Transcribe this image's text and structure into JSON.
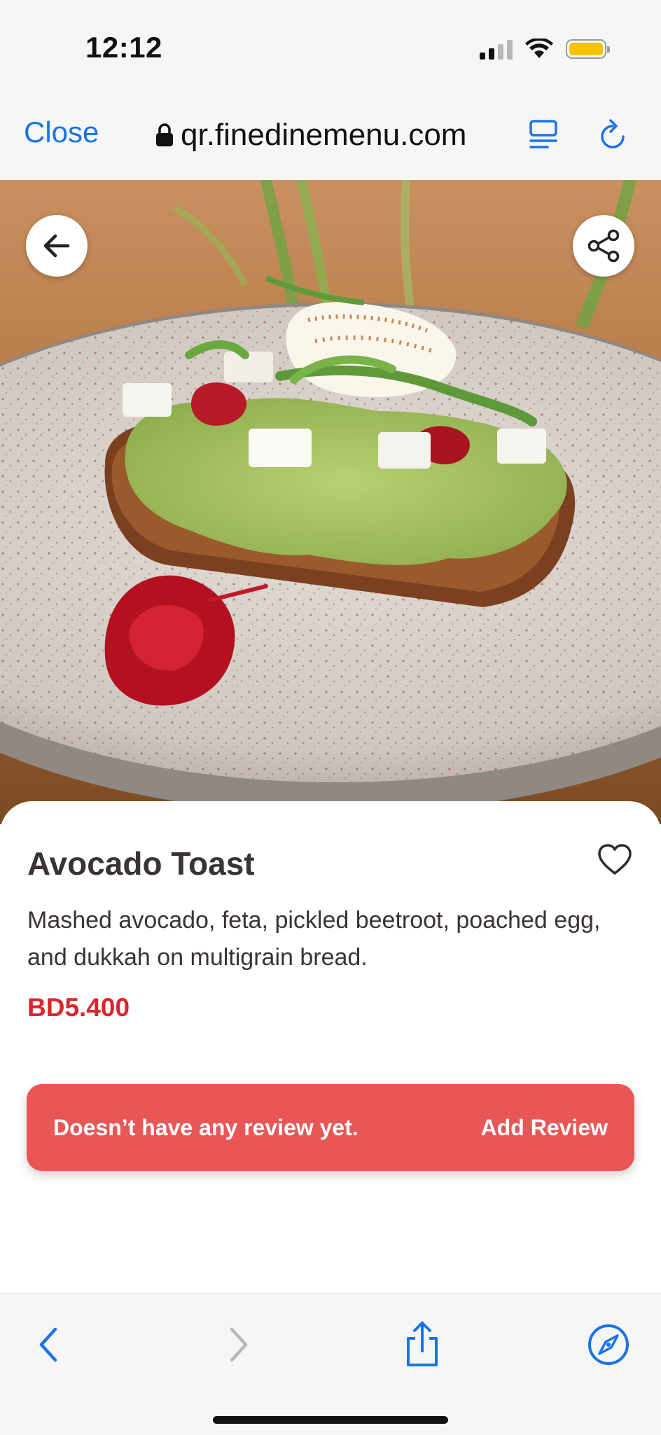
{
  "status_bar": {
    "time": "12:12",
    "battery_color": "#f5c400"
  },
  "browser": {
    "close_label": "Close",
    "url": "qr.finedinemenu.com",
    "accent_color": "#1a73e8"
  },
  "hero": {
    "image_subject": "avocado toast on speckled plate",
    "back_icon": "arrow-left-icon",
    "share_icon": "share-icon"
  },
  "item": {
    "title": "Avocado Toast",
    "description": "Mashed avocado, feta, pickled beetroot, poached egg, and dukkah on multigrain bread.",
    "price": "BD5.400",
    "favorite_icon": "heart-icon",
    "price_color": "#d9262d"
  },
  "review": {
    "status_text": "Doesn’t have any review yet.",
    "action_label": "Add Review",
    "bar_color": "#e95656"
  },
  "toolbar": {
    "icons": [
      "chevron-left-icon",
      "chevron-right-icon",
      "share-icon",
      "compass-icon"
    ]
  }
}
